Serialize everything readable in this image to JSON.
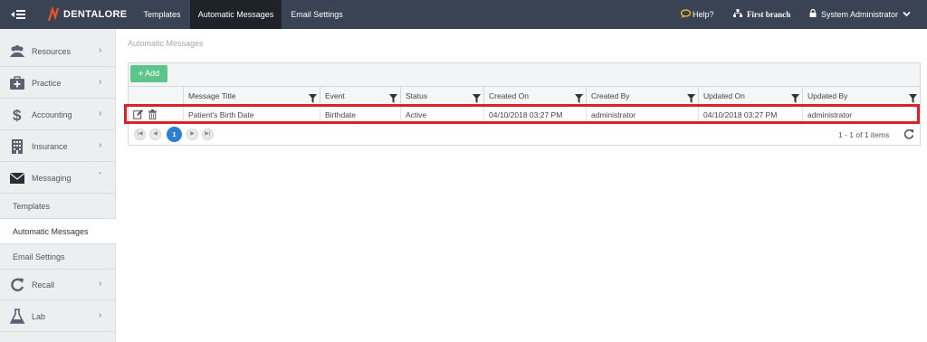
{
  "header": {
    "brand": "DENTALORE",
    "tabs": [
      {
        "label": "Templates"
      },
      {
        "label": "Automatic Messages"
      },
      {
        "label": "Email Settings"
      }
    ],
    "help": "Help?",
    "branch": "First branch",
    "user": "System Administrator"
  },
  "sidebar": {
    "items": [
      {
        "label": "Resources",
        "icon": "users-icon"
      },
      {
        "label": "Practice",
        "icon": "medical-kit-icon"
      },
      {
        "label": "Accounting",
        "icon": "dollar-icon"
      },
      {
        "label": "Insurance",
        "icon": "building-icon"
      },
      {
        "label": "Messaging",
        "icon": "envelope-icon"
      },
      {
        "label": "Recall",
        "icon": "refresh-icon"
      },
      {
        "label": "Lab",
        "icon": "flask-icon"
      }
    ],
    "subitems": [
      {
        "label": "Templates"
      },
      {
        "label": "Automatic Messages"
      },
      {
        "label": "Email Settings"
      }
    ]
  },
  "page": {
    "breadcrumb": "Automatic Messages",
    "add_label": "Add"
  },
  "grid": {
    "columns": [
      "Message Title",
      "Event",
      "Status",
      "Created On",
      "Created By",
      "Updated On",
      "Updated By"
    ],
    "rows": [
      {
        "title": "Patient's Birth Date",
        "event": "Birthdate",
        "status": "Active",
        "created_on": "04/10/2018 03:27 PM",
        "created_by": "administrator",
        "updated_on": "04/10/2018 03:27 PM",
        "updated_by": "administrator"
      }
    ],
    "current_page": "1",
    "items_info": "1 - 1 of 1 items"
  },
  "colors": {
    "header_bg": "#394353",
    "active_tab_bg": "#1e2229",
    "add_button": "#5cc58a",
    "pager_active": "#2d7fd1",
    "highlight": "#d8232a"
  }
}
